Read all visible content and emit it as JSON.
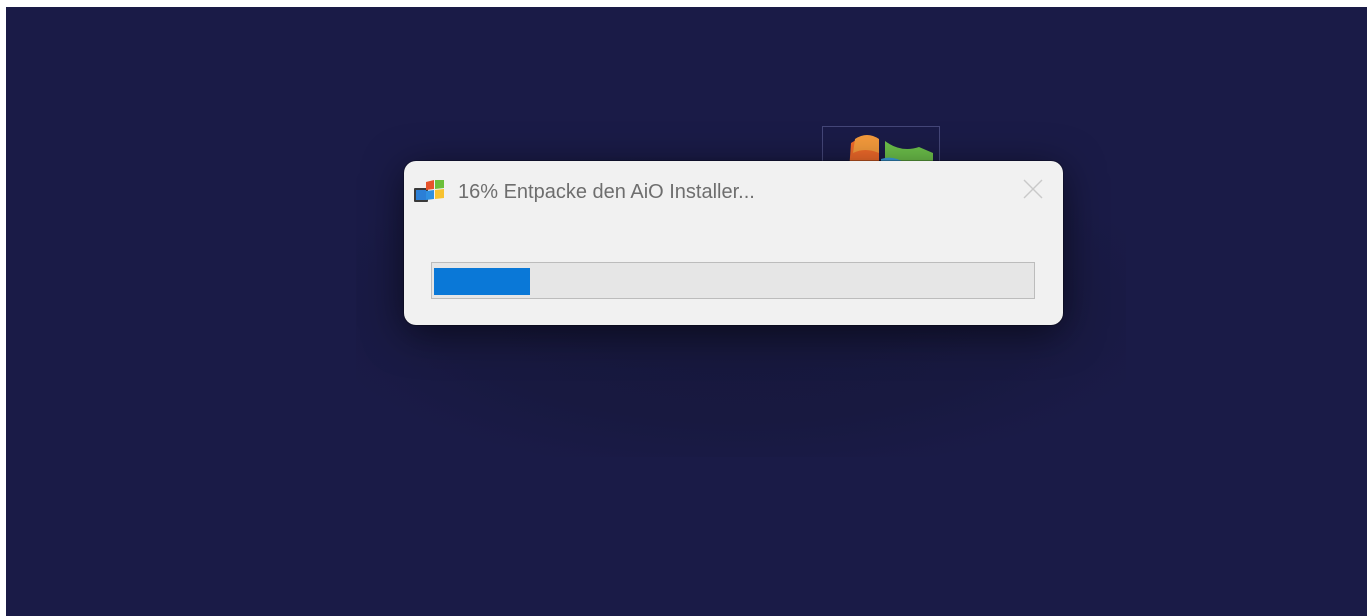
{
  "window": {
    "title": "16% Entpacke den AiO Installer...",
    "icon": "windows-installer-icon",
    "close_icon": "close-icon"
  },
  "progress": {
    "value": 0.16,
    "percent_label": "16%",
    "fill_color": "#0a78d7"
  },
  "desktop": {
    "background_color": "#1a1b47",
    "icon": "windows-logo-icon"
  }
}
